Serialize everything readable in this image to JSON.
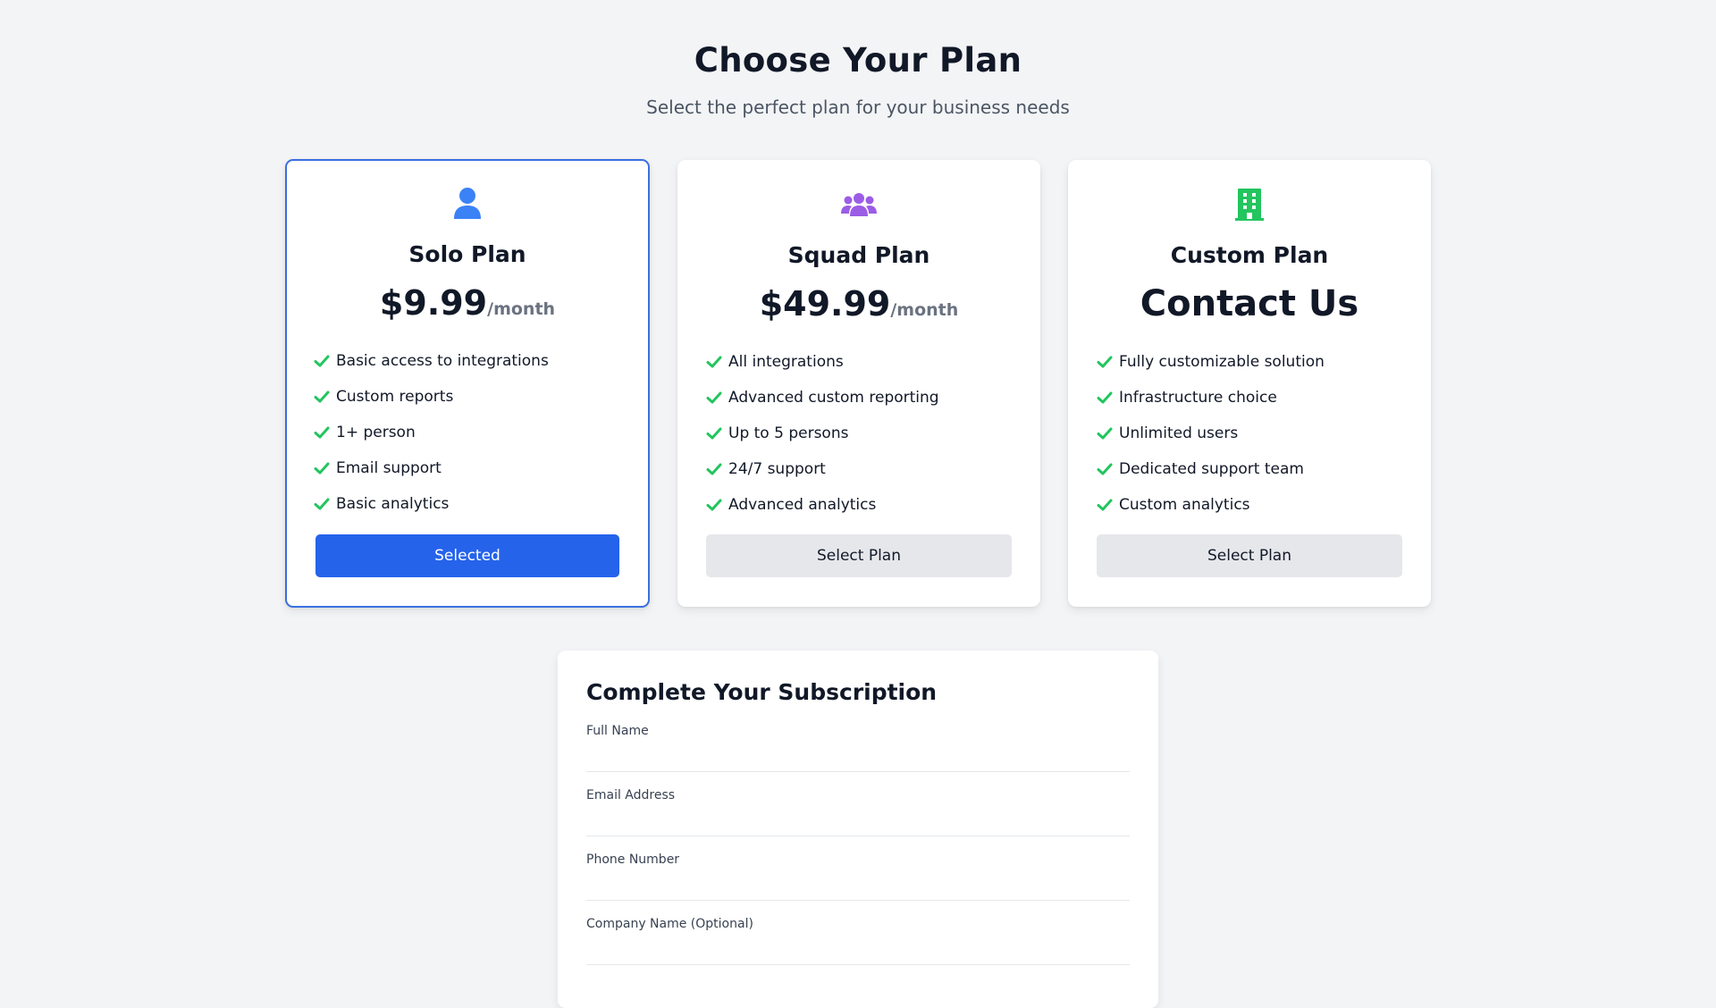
{
  "header": {
    "title": "Choose Your Plan",
    "subtitle": "Select the perfect plan for your business needs"
  },
  "plans": [
    {
      "icon": "user-icon",
      "icon_color": "#3b82f6",
      "name": "Solo Plan",
      "price": "$9.99",
      "period": "/month",
      "features": [
        "Basic access to integrations",
        "Custom reports",
        "1+ person",
        "Email support",
        "Basic analytics"
      ],
      "button_label": "Selected",
      "selected": true
    },
    {
      "icon": "users-icon",
      "icon_color": "#9b5de5",
      "name": "Squad Plan",
      "price": "$49.99",
      "period": "/month",
      "features": [
        "All integrations",
        "Advanced custom reporting",
        "Up to 5 persons",
        "24/7 support",
        "Advanced analytics"
      ],
      "button_label": "Select Plan",
      "selected": false
    },
    {
      "icon": "building-icon",
      "icon_color": "#22c55e",
      "name": "Custom Plan",
      "price": "Contact Us",
      "period": "",
      "features": [
        "Fully customizable solution",
        "Infrastructure choice",
        "Unlimited users",
        "Dedicated support team",
        "Custom analytics"
      ],
      "button_label": "Select Plan",
      "selected": false
    }
  ],
  "colors": {
    "accent": "#2563eb",
    "check": "#22c55e",
    "selected_border": "#3b6fe0"
  },
  "form": {
    "title": "Complete Your Subscription",
    "fields": [
      {
        "label": "Full Name",
        "value": ""
      },
      {
        "label": "Email Address",
        "value": ""
      },
      {
        "label": "Phone Number",
        "value": ""
      },
      {
        "label": "Company Name (Optional)",
        "value": ""
      }
    ]
  }
}
